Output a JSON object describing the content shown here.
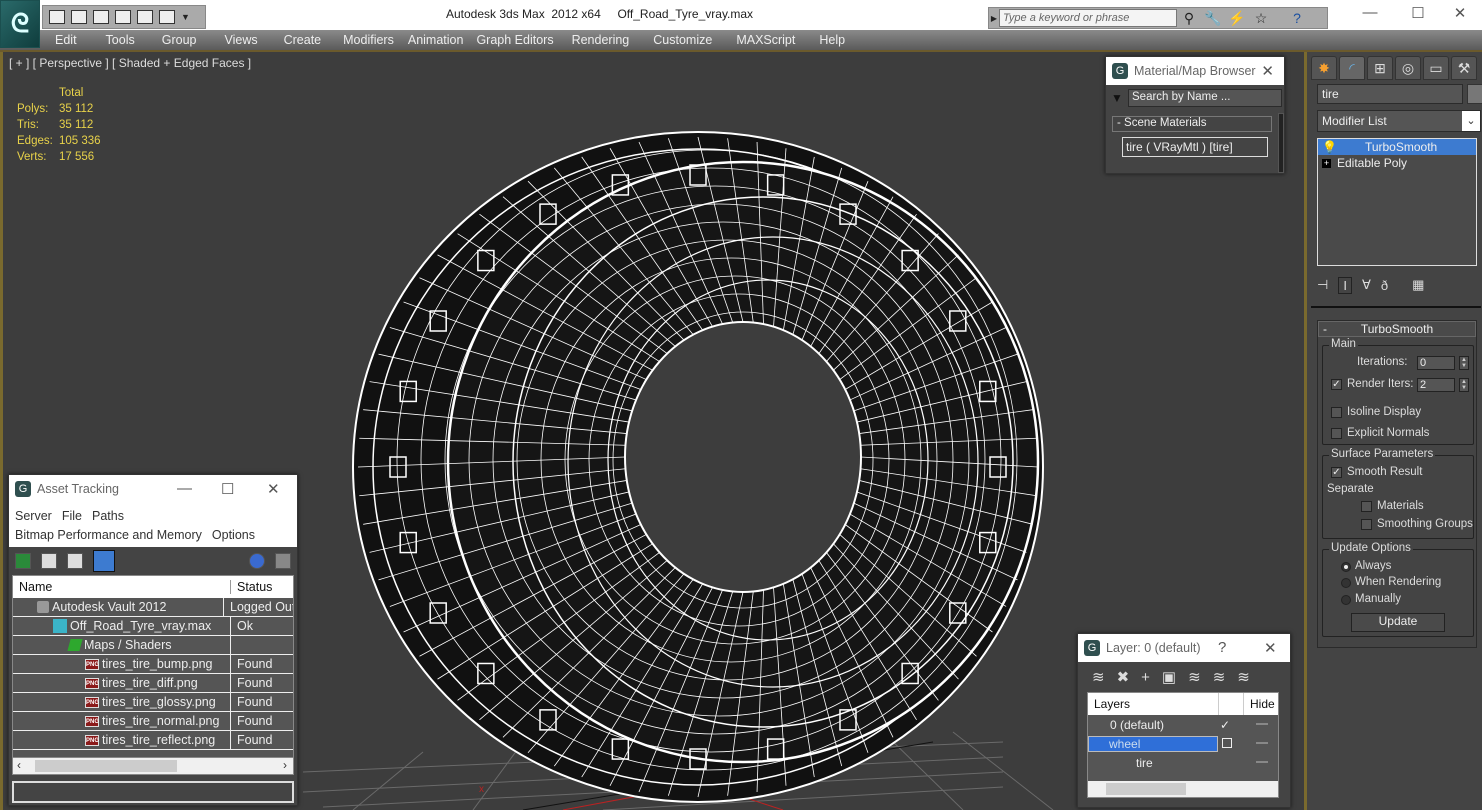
{
  "titlebar": {
    "app_title": "Autodesk 3ds Max  2012 x64",
    "file_name": "Off_Road_Tyre_vray.max",
    "search_placeholder": "Type a keyword or phrase",
    "window_controls": {
      "minimize": "—",
      "maximize": "☐",
      "close": "✕"
    }
  },
  "menubar": {
    "items": [
      "Edit",
      "Tools",
      "Group",
      "Views",
      "Create",
      "Modifiers",
      "Animation",
      "Graph Editors",
      "Rendering",
      "Customize",
      "MAXScript",
      "Help"
    ]
  },
  "viewport": {
    "label": "[ + ] [ Perspective ] [ Shaded + Edged Faces ]",
    "stats": {
      "header": "Total",
      "rows": [
        {
          "key": "Polys:",
          "value": "35 112"
        },
        {
          "key": "Tris:",
          "value": "35 112"
        },
        {
          "key": "Edges:",
          "value": "105 336"
        },
        {
          "key": "Verts:",
          "value": "17 556"
        }
      ]
    },
    "axis_label": "x"
  },
  "material_browser": {
    "title": "Material/Map Browser",
    "search_placeholder": "Search by Name ...",
    "group": "-  Scene Materials",
    "item": "tire  ( VRayMtl ) [tire]"
  },
  "asset_tracking": {
    "title": "Asset Tracking",
    "menu_row1": [
      "Server",
      "File",
      "Paths"
    ],
    "menu_row2": [
      "Bitmap Performance and Memory",
      "Options"
    ],
    "columns": [
      "Name",
      "Status"
    ],
    "rows": [
      {
        "name": "Autodesk Vault 2012",
        "status": "Logged Out",
        "icon": "vault-icon",
        "indent": 1
      },
      {
        "name": "Off_Road_Tyre_vray.max",
        "status": "Ok",
        "icon": "max-file-icon",
        "indent": 2
      },
      {
        "name": "Maps / Shaders",
        "status": "",
        "icon": "maps-icon",
        "indent": 3
      },
      {
        "name": "tires_tire_bump.png",
        "status": "Found",
        "icon": "png-icon",
        "indent": 4
      },
      {
        "name": "tires_tire_diff.png",
        "status": "Found",
        "icon": "png-icon",
        "indent": 4
      },
      {
        "name": "tires_tire_glossy.png",
        "status": "Found",
        "icon": "png-icon",
        "indent": 4
      },
      {
        "name": "tires_tire_normal.png",
        "status": "Found",
        "icon": "png-icon",
        "indent": 4
      },
      {
        "name": "tires_tire_reflect.png",
        "status": "Found",
        "icon": "png-icon",
        "indent": 4
      }
    ]
  },
  "layer_manager": {
    "title": "Layer: 0 (default)",
    "help": "?",
    "columns": [
      "Layers",
      "Hide"
    ],
    "rows": [
      {
        "name": "0 (default)",
        "current": true
      },
      {
        "name": "wheel",
        "selected": true
      },
      {
        "name": "tire",
        "child": true
      }
    ]
  },
  "command_panel": {
    "object_name": "tire",
    "modifier_list": "Modifier List",
    "stack": [
      {
        "name": "TurboSmooth",
        "selected": true
      },
      {
        "name": "Editable Poly",
        "selected": false
      }
    ],
    "turbosmooth": {
      "title": "TurboSmooth",
      "main_group": "Main",
      "iterations_label": "Iterations:",
      "iterations": "0",
      "render_iters_label": "Render Iters:",
      "render_iters": "2",
      "render_iters_checked": true,
      "isoline_display": "Isoline Display",
      "explicit_normals": "Explicit Normals",
      "surface_group": "Surface Parameters",
      "smooth_result": "Smooth Result",
      "separate": "Separate",
      "materials": "Materials",
      "smoothing_groups": "Smoothing Groups",
      "update_group": "Update Options",
      "always": "Always",
      "when_rendering": "When Rendering",
      "manually": "Manually",
      "update_button": "Update"
    }
  }
}
